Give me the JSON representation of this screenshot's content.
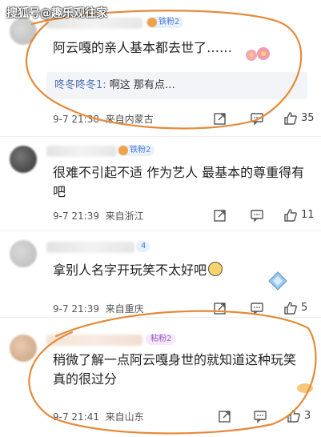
{
  "watermark": "搜狐号@趣乐观往家",
  "colors": {
    "annotation": "#e58a3a",
    "reply_user": "#4a6fb5",
    "badge_bg": "#e8f0fc"
  },
  "comments": [
    {
      "badge": "铁粉2",
      "text": "阿云嘎的亲人基本都去世了……",
      "reply": {
        "user": "咚冬咚冬1:",
        "text": " 啊这 那有点…"
      },
      "time": "9-7 21:38",
      "location": "来自内蒙古",
      "likes": "35"
    },
    {
      "badge": "铁粉2",
      "text": "很难不引起不适 作为艺人 最基本的尊重得有吧",
      "time": "9-7 21:39",
      "location": "来自浙江",
      "likes": "11"
    },
    {
      "badge": "4",
      "text": "拿别人名字开玩笑不太好吧",
      "time": "9-7 21:39",
      "location": "来自重庆",
      "likes": "5"
    },
    {
      "badge": "粘粉2",
      "text": "稍微了解一点阿云嘎身世的就知道这种玩笑真的很过分",
      "time": "9-7 21:41",
      "location": "来自山东",
      "likes": "3"
    }
  ],
  "icons": {
    "share": "share-icon",
    "comment": "comment-icon",
    "like": "like-icon"
  }
}
